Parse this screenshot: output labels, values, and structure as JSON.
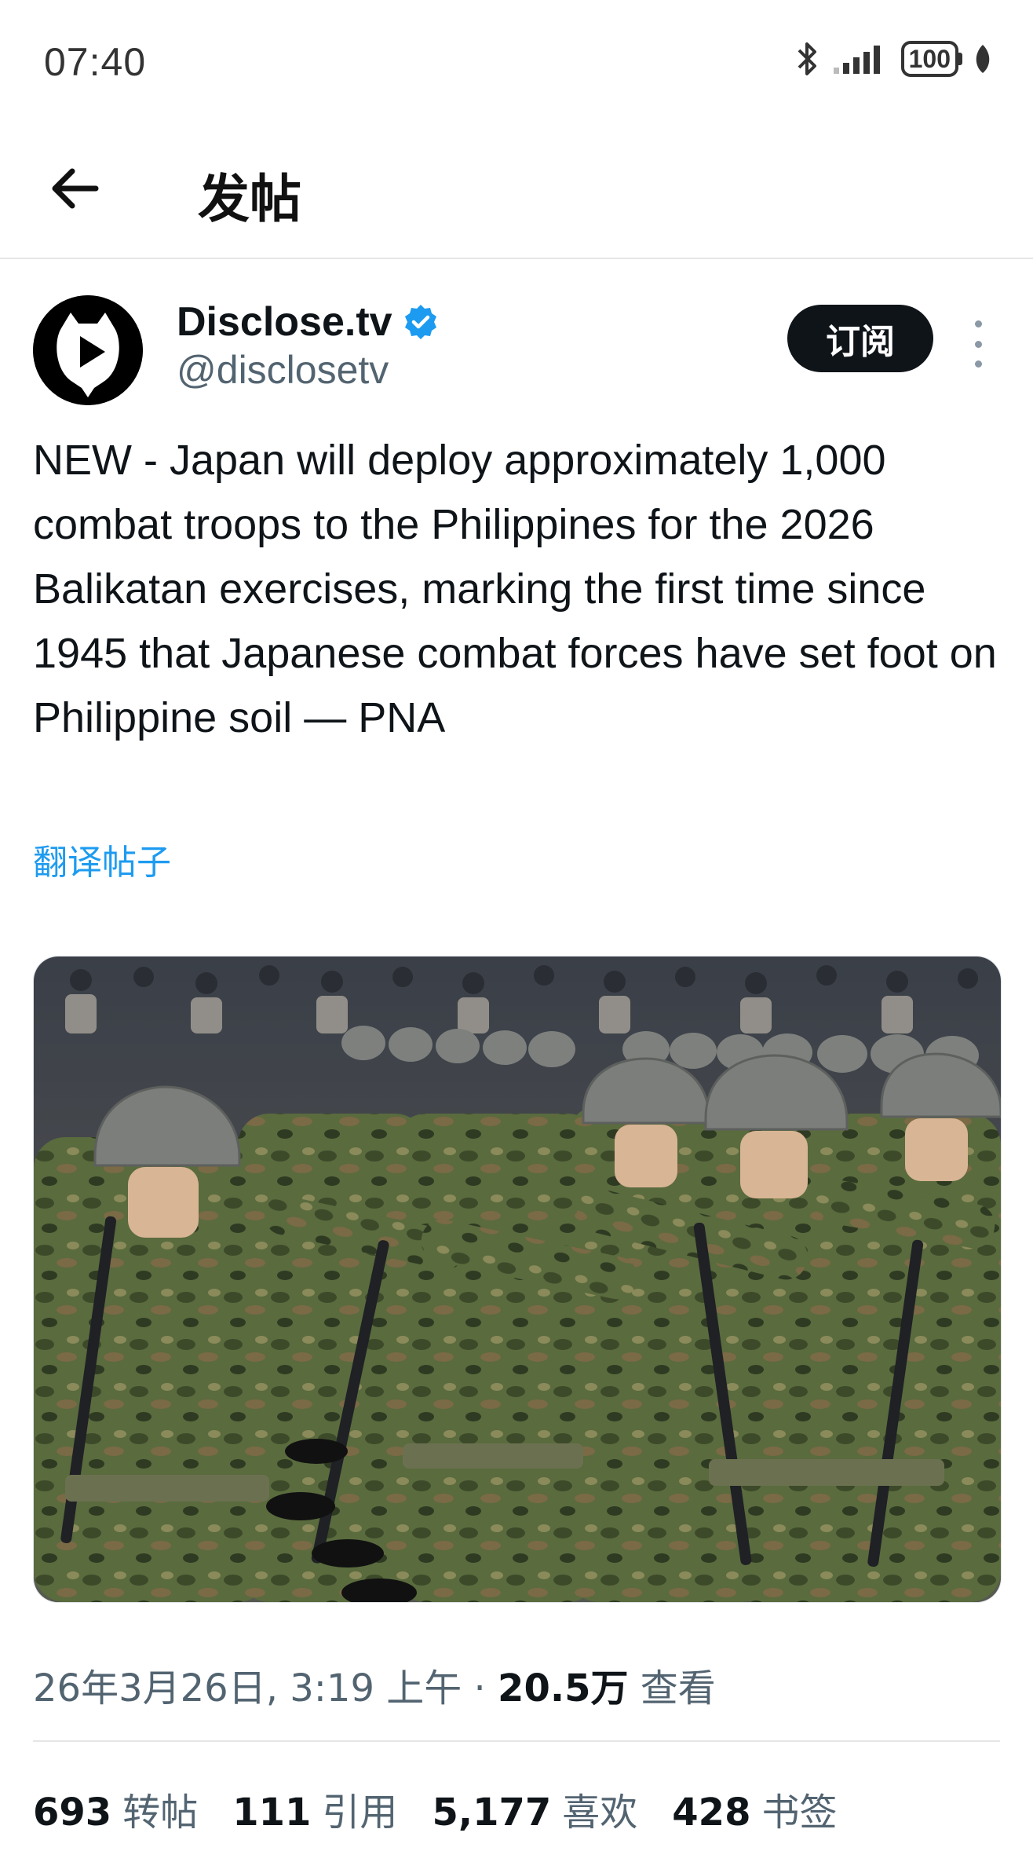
{
  "status_bar": {
    "time": "07:40",
    "battery": "100"
  },
  "header": {
    "title": "发帖"
  },
  "author": {
    "name": "Disclose.tv",
    "handle": "@disclosetv",
    "verified": true
  },
  "subscribe_label": "订阅",
  "tweet": {
    "text": "NEW - Japan will deploy approximately 1,000 combat troops to the Philippines for the 2026 Balikatan exercises, marking the first time since 1945 that Japanese combat forces have set foot on Philippine soil — PNA",
    "translate_label": "翻译帖子"
  },
  "meta": {
    "date": "26年3月26日, 3:19 上午",
    "separator": " · ",
    "views_count": "20.5万",
    "views_label": "查看"
  },
  "stats": [
    {
      "count": "693",
      "label": "转帖"
    },
    {
      "count": "111",
      "label": "引用"
    },
    {
      "count": "5,177",
      "label": "喜欢"
    },
    {
      "count": "428",
      "label": "书签"
    }
  ],
  "colors": {
    "accent": "#1d9bf0",
    "text": "#0f1419",
    "secondary": "#536471",
    "camouflage": "#5a6b3e"
  },
  "icons": [
    "bluetooth-icon",
    "signal-icon",
    "battery-icon",
    "leaf-icon",
    "back-arrow-icon",
    "verified-badge-icon",
    "more-options-icon"
  ]
}
